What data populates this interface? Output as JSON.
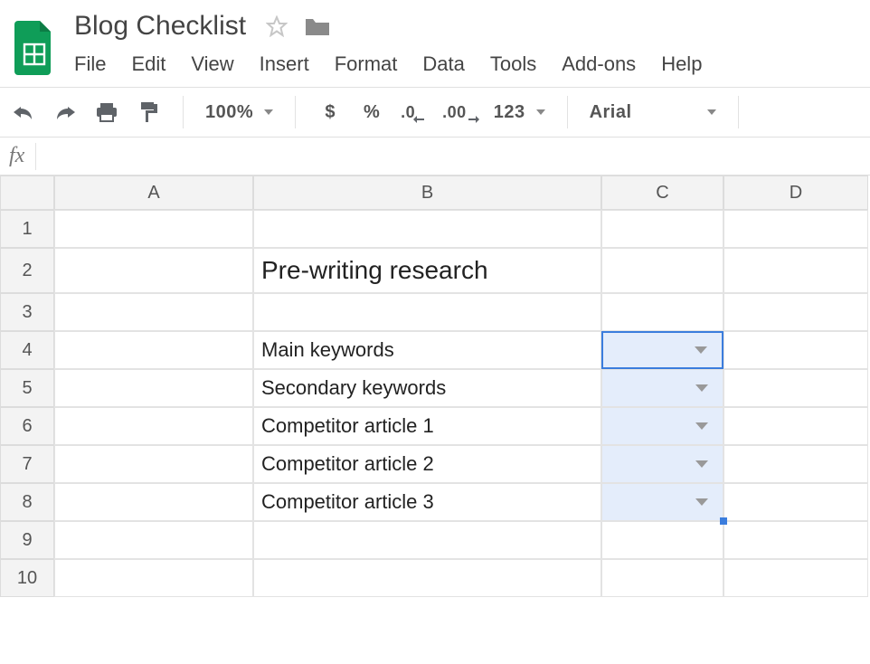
{
  "header": {
    "doc_title": "Blog Checklist"
  },
  "menus": [
    "File",
    "Edit",
    "View",
    "Insert",
    "Format",
    "Data",
    "Tools",
    "Add-ons",
    "Help"
  ],
  "toolbar": {
    "zoom": "100%",
    "currency": "$",
    "percent": "%",
    "dec_decrease": ".0",
    "dec_increase": ".00",
    "number_format": "123",
    "font": "Arial"
  },
  "fx_label": "fx",
  "columns": [
    "A",
    "B",
    "C",
    "D"
  ],
  "rows": [
    "1",
    "2",
    "3",
    "4",
    "5",
    "6",
    "7",
    "8",
    "9",
    "10"
  ],
  "cells": {
    "b2": "Pre-writing research",
    "b4": "Main keywords",
    "b5": "Secondary keywords",
    "b6": "Competitor article 1",
    "b7": "Competitor article 2",
    "b8": "Competitor article 3"
  },
  "selection": {
    "active": "C4",
    "range": "C4:C8"
  }
}
